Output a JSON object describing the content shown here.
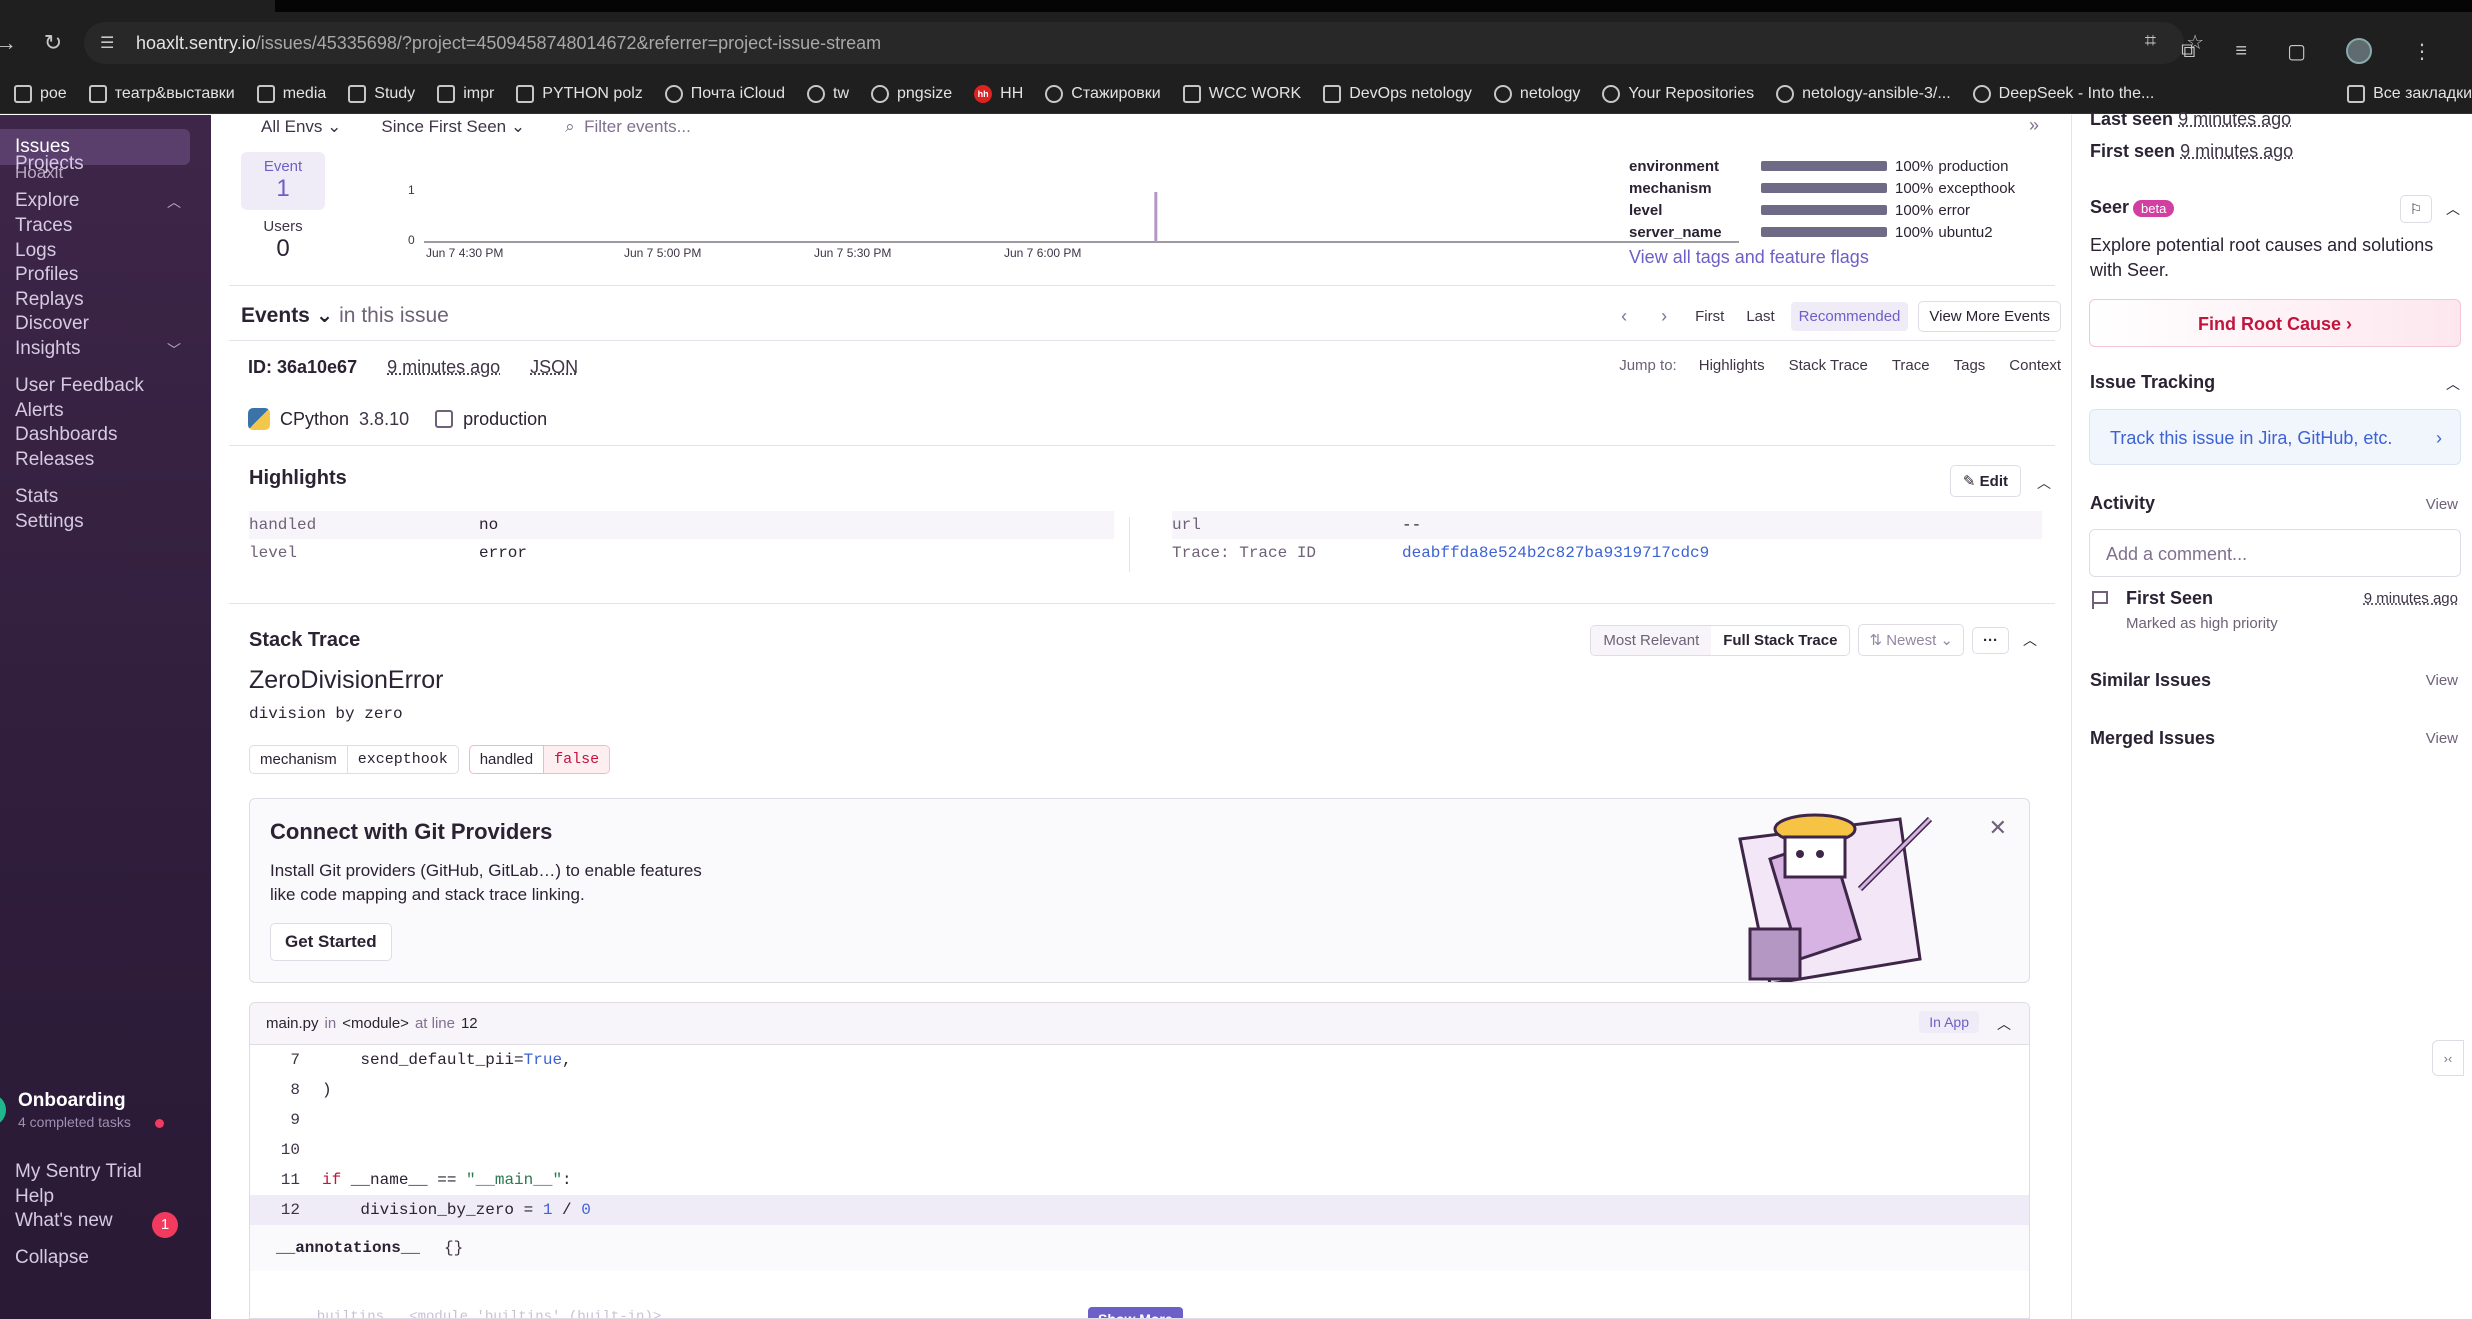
{
  "browser": {
    "url_host": "hoaxlt.sentry.io",
    "url_path": "/issues/45335698/?project=4509458748014672&referrer=project-issue-stream",
    "bookmarks": [
      {
        "label": "poe",
        "icon": "folder-icon"
      },
      {
        "label": "театр&выставки",
        "icon": "folder-icon"
      },
      {
        "label": "media",
        "icon": "folder-icon"
      },
      {
        "label": "Study",
        "icon": "folder-icon"
      },
      {
        "label": "impr",
        "icon": "folder-icon"
      },
      {
        "label": "PYTHON polz",
        "icon": "folder-icon"
      },
      {
        "label": "Почта iCloud",
        "icon": "apple-icon"
      },
      {
        "label": "tw",
        "icon": "globe-icon"
      },
      {
        "label": "pngsize",
        "icon": "cloud-icon"
      },
      {
        "label": "HH",
        "icon": "hh-icon"
      },
      {
        "label": "Стажировки",
        "icon": "ostrich-icon"
      },
      {
        "label": "WCC WORK",
        "icon": "folder-icon"
      },
      {
        "label": "DevOps netology",
        "icon": "folder-icon"
      },
      {
        "label": "netology",
        "icon": "netology-icon"
      },
      {
        "label": "Your Repositories",
        "icon": "github-icon"
      },
      {
        "label": "netology-ansible-3/...",
        "icon": "github-icon"
      },
      {
        "label": "DeepSeek - Into the...",
        "icon": "deepseek-icon"
      }
    ],
    "bookmarks_all": "Все закладки"
  },
  "sidebar": {
    "org_name": "hoaxlt",
    "org_sub": "Hoaxlt",
    "items": [
      {
        "label": "Issues",
        "active": true
      },
      {
        "label": "Projects"
      },
      {
        "label": "Explore",
        "group": true
      },
      {
        "label": "Traces"
      },
      {
        "label": "Logs"
      },
      {
        "label": "Profiles"
      },
      {
        "label": "Replays"
      },
      {
        "label": "Discover"
      },
      {
        "label": "Insights",
        "group": true
      },
      {
        "label": "User Feedback"
      },
      {
        "label": "Alerts"
      },
      {
        "label": "Dashboards"
      },
      {
        "label": "Releases"
      },
      {
        "label": "Stats"
      },
      {
        "label": "Settings"
      }
    ],
    "onboarding_title": "Onboarding",
    "onboarding_sub": "4 completed tasks",
    "bottom": [
      {
        "label": "My Sentry Trial"
      },
      {
        "label": "Help"
      },
      {
        "label": "What's new",
        "badge": "1"
      },
      {
        "label": "Collapse"
      }
    ]
  },
  "filters": {
    "env": "All Envs",
    "period": "Since First Seen",
    "search_placeholder": "Filter events..."
  },
  "stats": {
    "event_label": "Event",
    "event_value": "1",
    "users_label": "Users",
    "users_value": "0"
  },
  "chart_data": {
    "type": "bar",
    "x_ticks": [
      "Jun 7 4:30 PM",
      "Jun 7 5:00 PM",
      "Jun 7 5:30 PM",
      "Jun 7 6:00 PM"
    ],
    "y_ticks": [
      "0",
      "1"
    ],
    "ylim": [
      0,
      1
    ],
    "points": [
      {
        "x": "Jun 7 6:25 PM",
        "y": 1
      }
    ],
    "bar_color": "#b597c4"
  },
  "tags_summary": [
    {
      "key": "environment",
      "pct": "100%",
      "value": "production",
      "fill": 1.0
    },
    {
      "key": "mechanism",
      "pct": "100%",
      "value": "excepthook",
      "fill": 1.0
    },
    {
      "key": "level",
      "pct": "100%",
      "value": "error",
      "fill": 1.0
    },
    {
      "key": "server_name",
      "pct": "100%",
      "value": "ubuntu2",
      "fill": 1.0
    }
  ],
  "tags_link": "View all tags and feature flags",
  "events": {
    "title": "Events",
    "sub": "in this issue",
    "nav_first": "First",
    "nav_last": "Last",
    "nav_recommended": "Recommended",
    "nav_more": "View More Events",
    "id_label": "ID: 36a10e67",
    "time_ago": "9 minutes ago",
    "json": "JSON",
    "jump_label": "Jump to:",
    "jump_items": [
      "Highlights",
      "Stack Trace",
      "Trace",
      "Tags",
      "Context"
    ],
    "runtime": "CPython",
    "runtime_ver": "3.8.10",
    "environment": "production"
  },
  "highlights": {
    "title": "Highlights",
    "edit": "Edit",
    "left": [
      {
        "k": "handled",
        "v": "no"
      },
      {
        "k": "level",
        "v": "error"
      }
    ],
    "right": [
      {
        "k": "url",
        "v": "--"
      },
      {
        "k": "Trace: Trace ID",
        "v": "deabffda8e524b2c827ba9319717cdc9"
      }
    ]
  },
  "stacktrace": {
    "title": "Stack Trace",
    "mode_relevant": "Most Relevant",
    "mode_full": "Full Stack Trace",
    "sort": "Newest",
    "more": "···",
    "error_type": "ZeroDivisionError",
    "error_msg": "division by zero",
    "chips": [
      {
        "k": "mechanism",
        "v": "excepthook"
      },
      {
        "k": "handled",
        "v": "false"
      }
    ]
  },
  "git_card": {
    "title": "Connect with Git Providers",
    "desc": "Install Git providers (GitHub, GitLab…) to enable features like code mapping and stack trace linking.",
    "button": "Get Started"
  },
  "frame": {
    "file": "main.py",
    "in": "in",
    "func": "<module>",
    "at_line": "at line",
    "line_no": "12",
    "in_app": "In App",
    "lines": [
      {
        "n": "7",
        "code": "    send_default_pii=True,"
      },
      {
        "n": "8",
        "code": ")"
      },
      {
        "n": "9",
        "code": ""
      },
      {
        "n": "10",
        "code": ""
      },
      {
        "n": "11",
        "code": "if __name__ == \"__main__\":"
      },
      {
        "n": "12",
        "code": "    division_by_zero = 1 / 0"
      }
    ],
    "var_name": "__annotations__",
    "var_value": "{}",
    "faded_text": "__builtins__   <module 'builtins' (built-in)>",
    "show_more": "Show More"
  },
  "right_panel": {
    "last_seen_label": "Last seen",
    "last_seen": "9 minutes ago",
    "first_seen_label": "First seen",
    "first_seen": "9 minutes ago",
    "seer_title": "Seer",
    "seer_badge": "beta",
    "seer_desc": "Explore potential root causes and solutions with Seer.",
    "root_cause_btn": "Find Root Cause",
    "issue_tracking": "Issue Tracking",
    "track_link": "Track this issue in Jira, GitHub, etc.",
    "activity": "Activity",
    "view": "View",
    "comment_placeholder": "Add a comment...",
    "first_seen_act": "First Seen",
    "first_seen_act_time": "9 minutes ago",
    "first_seen_act_sub": "Marked as high priority",
    "similar": "Similar Issues",
    "merged": "Merged Issues"
  }
}
